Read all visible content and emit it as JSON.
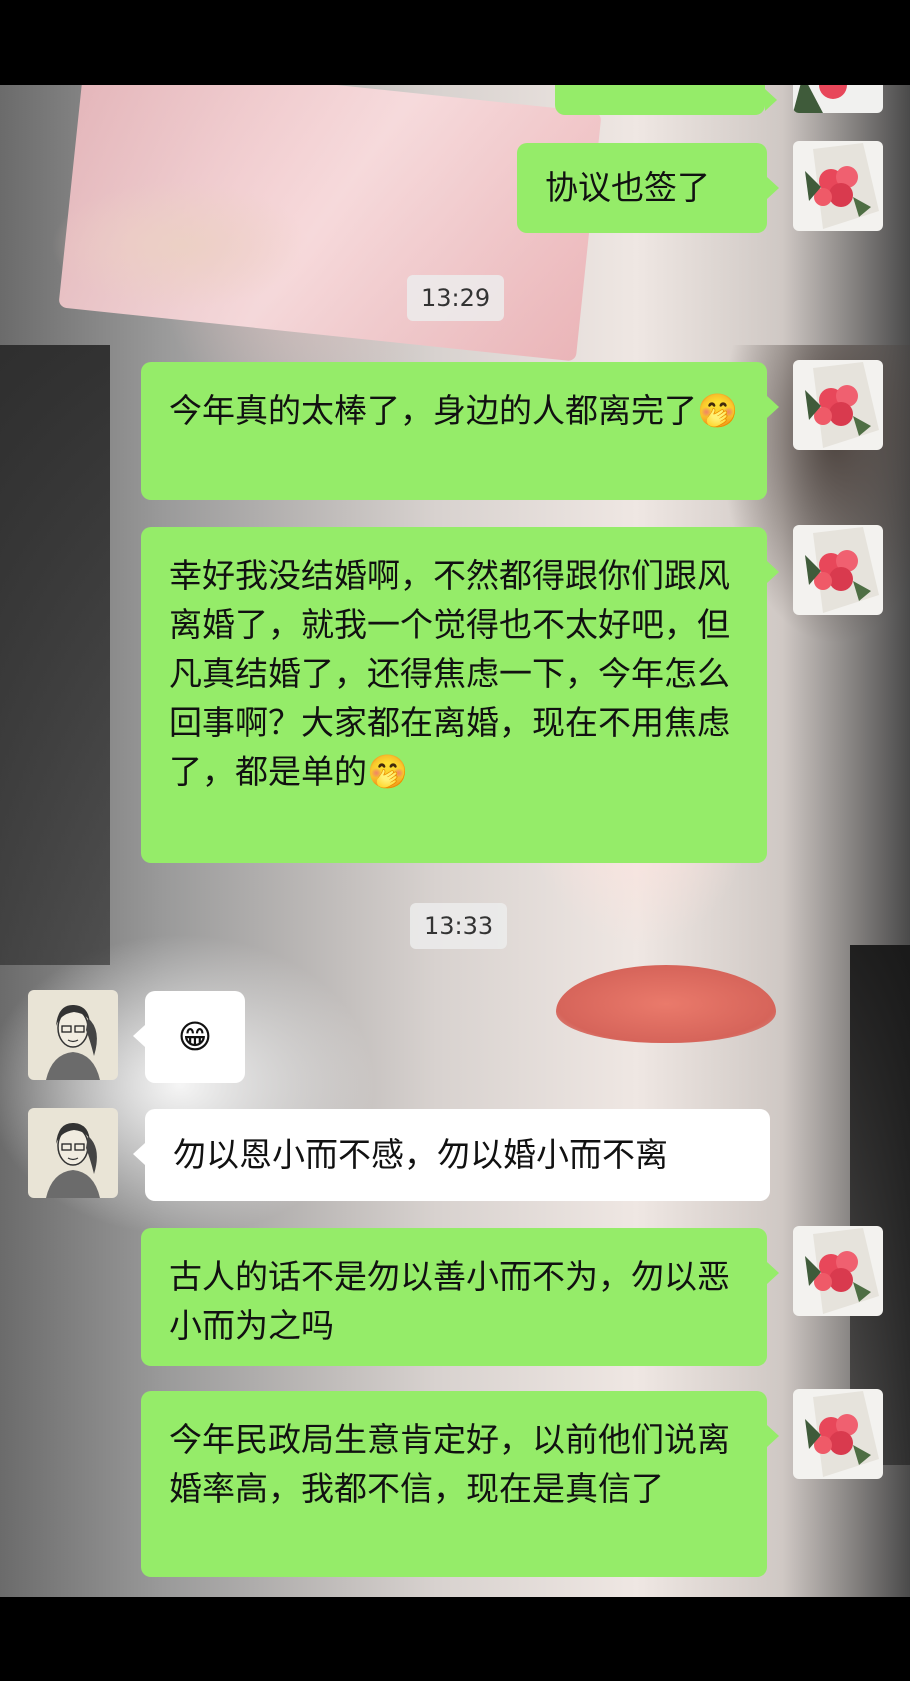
{
  "messages": [
    {
      "side": "right",
      "text": "协议也签了"
    },
    {
      "side": "time",
      "text": "13:29"
    },
    {
      "side": "right",
      "text": "今年真的太棒了，身边的人都离完了",
      "emoji": "🤭"
    },
    {
      "side": "right",
      "text": "幸好我没结婚啊，不然都得跟你们跟风离婚了，就我一个觉得也不太好吧，但凡真结婚了，还得焦虑一下，今年怎么回事啊？大家都在离婚，现在不用焦虑了，都是单的",
      "emoji": "🤭"
    },
    {
      "side": "time",
      "text": "13:33"
    },
    {
      "side": "left",
      "text": "",
      "emoji": "😁"
    },
    {
      "side": "left",
      "text": "勿以恩小而不感，勿以婚小而不离"
    },
    {
      "side": "right",
      "text": "古人的话不是勿以善小而不为，勿以恶小而为之吗"
    },
    {
      "side": "right",
      "text": "今年民政局生意肯定好，以前他们说离婚率高，我都不信，现在是真信了"
    }
  ],
  "avatars": {
    "me": "flower-bouquet-avatar",
    "friend": "sketch-girl-avatar"
  },
  "colors": {
    "bubble_self": "#95ec69",
    "bubble_other": "#ffffff",
    "time_bg": "#ececec"
  }
}
